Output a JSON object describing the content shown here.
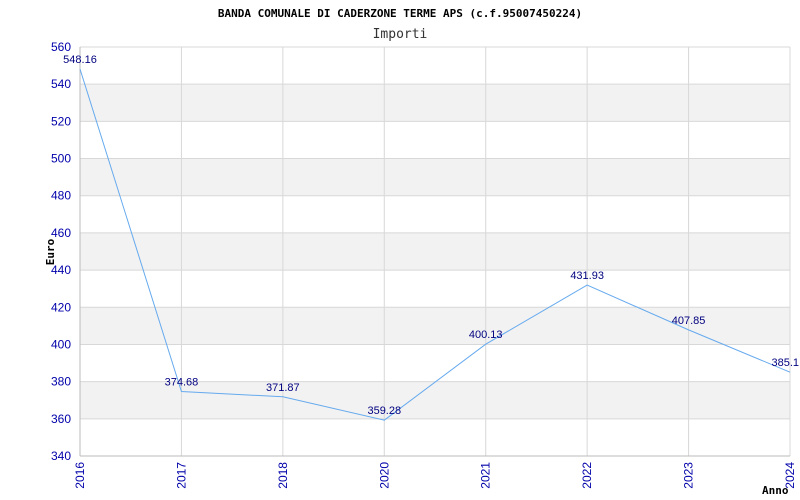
{
  "chart_data": {
    "type": "line",
    "title": "BANDA COMUNALE DI CADERZONE TERME APS (c.f.95007450224)",
    "subtitle": "Importi",
    "xlabel": "Anno",
    "ylabel": "Euro",
    "x": [
      "2016",
      "2017",
      "2018",
      "2020",
      "2021",
      "2022",
      "2023",
      "2024"
    ],
    "series": [
      {
        "values": [
          548.16,
          374.68,
          371.87,
          359.28,
          400.13,
          431.93,
          407.85,
          385.1
        ]
      }
    ],
    "data_labels": [
      "548.16",
      "374.68",
      "371.87",
      "359.28",
      "400.13",
      "431.93",
      "407.85",
      "385.1"
    ],
    "ylim": [
      340,
      560
    ],
    "yticks": [
      340,
      360,
      380,
      400,
      420,
      440,
      460,
      480,
      500,
      520,
      540,
      560
    ],
    "grid": true,
    "colors": {
      "line": "#66aaee",
      "band": "#f2f2f2",
      "grid": "#d8d8d8",
      "tick_text": "#0000aa",
      "data_label": "#000080"
    }
  }
}
